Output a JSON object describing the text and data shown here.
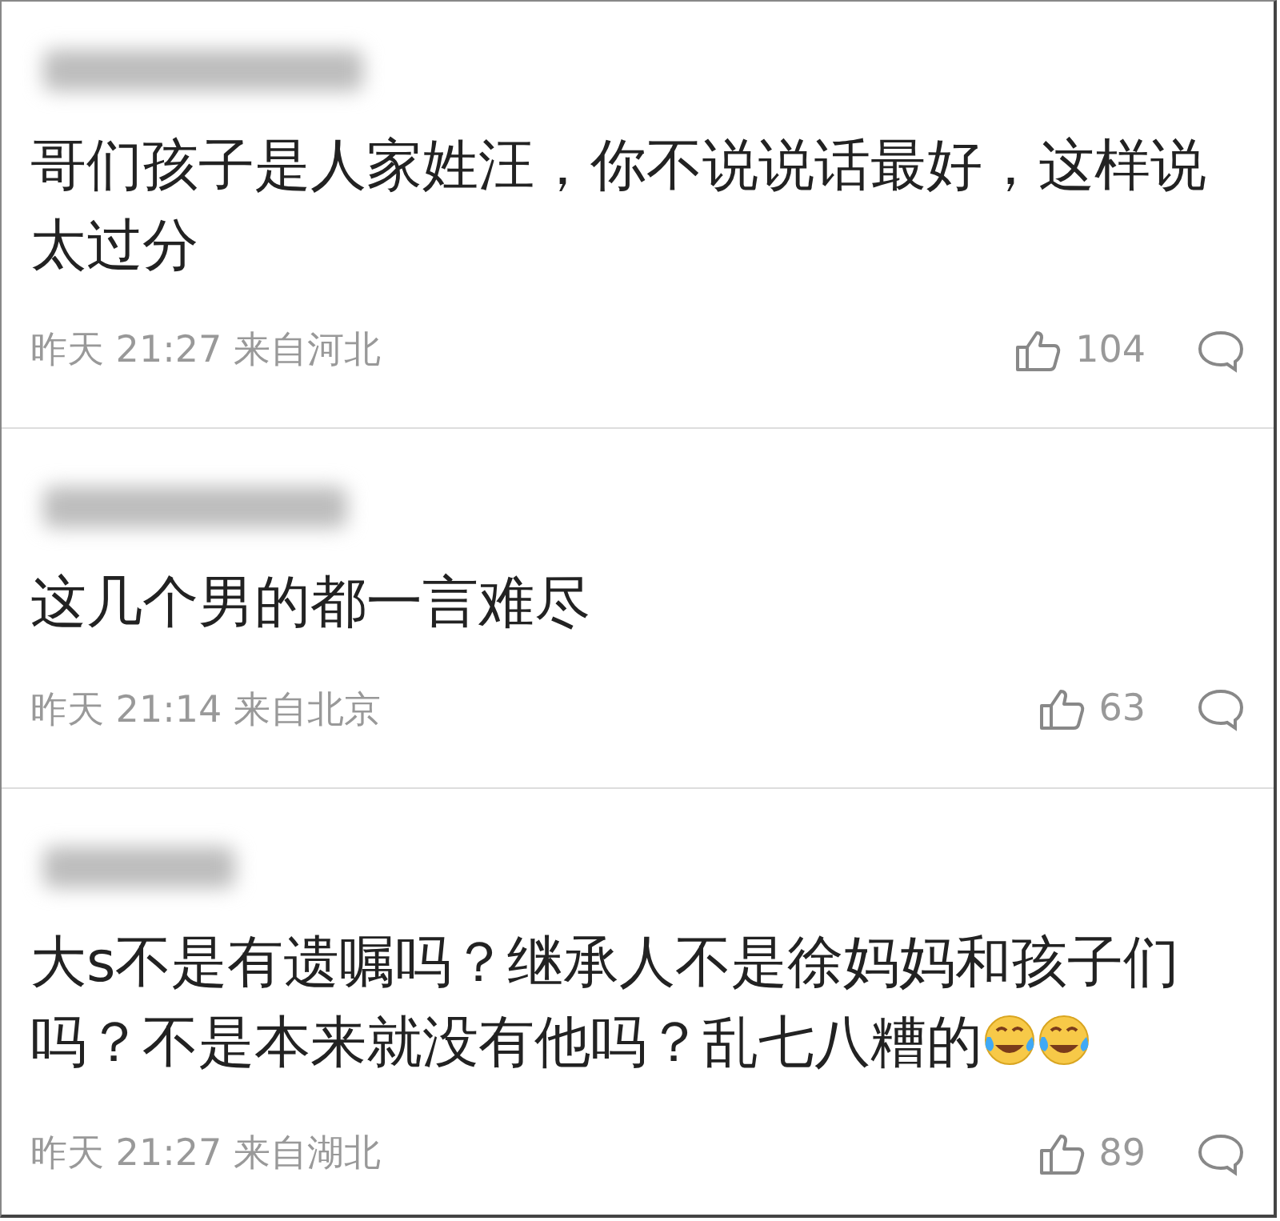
{
  "comments": [
    {
      "text": "哥们孩子是人家姓汪，你不说说话最好，这样说太过分",
      "time": "昨天 21:27 来自河北",
      "likes": "104"
    },
    {
      "text": "这几个男的都一言难尽",
      "time": "昨天 21:14 来自北京",
      "likes": "63"
    },
    {
      "text": "大s不是有遗嘱吗？继承人不是徐妈妈和孩子们吗？不是本来就没有他吗？乱七八糟的",
      "emojis": [
        {
          "kind": "laughing"
        },
        {
          "kind": "laughing"
        }
      ],
      "time": "昨天 21:27 来自湖北",
      "likes": "89"
    }
  ]
}
